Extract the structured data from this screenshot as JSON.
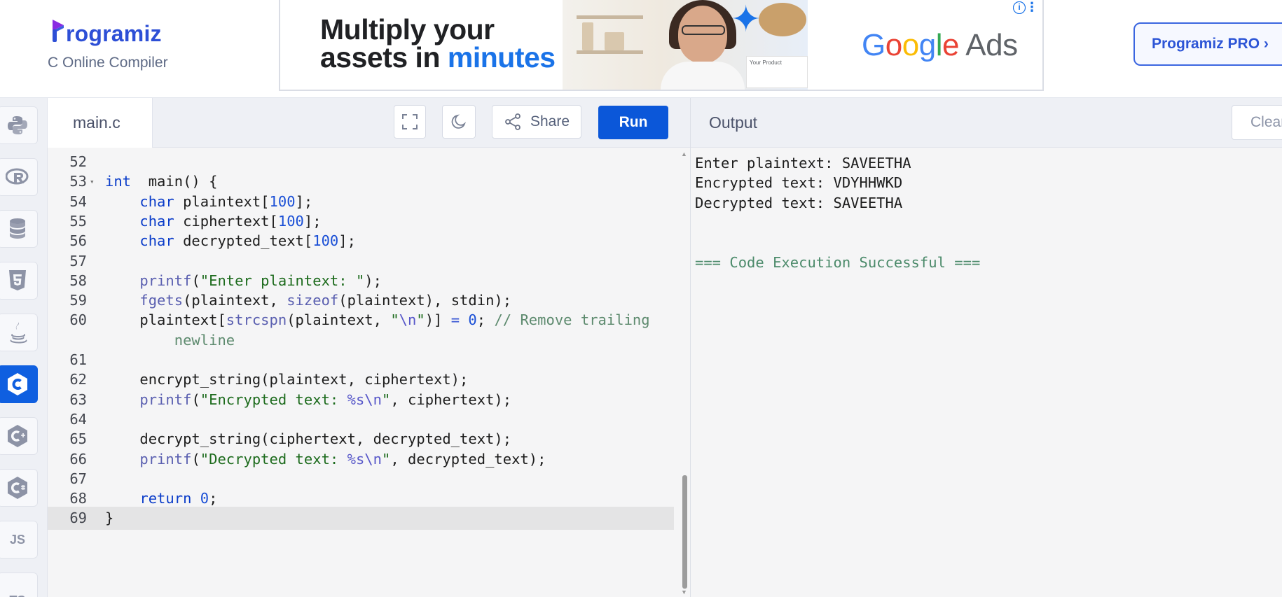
{
  "header": {
    "logo_text": "rogramiz",
    "logo_sub": "C Online Compiler",
    "pro_button": "Programiz PRO ›"
  },
  "ad": {
    "headline_line1": "Multiply your",
    "headline_line2_prefix": "assets in ",
    "headline_line2_highlight": "minutes",
    "brand_google": "Google",
    "brand_ads": "Ads",
    "card_label": "Your Product",
    "info_icon": "ⓘ",
    "menu_icon": "⋮"
  },
  "sidebar": {
    "items": [
      {
        "icon": "python-icon",
        "active": false
      },
      {
        "icon": "r-icon",
        "active": false
      },
      {
        "icon": "database-icon",
        "active": false
      },
      {
        "icon": "html5-icon",
        "active": false
      },
      {
        "icon": "java-icon",
        "active": false
      },
      {
        "icon": "c-icon",
        "active": true
      },
      {
        "icon": "cpp-icon",
        "active": false
      },
      {
        "icon": "csharp-icon",
        "active": false
      },
      {
        "icon": "js-icon",
        "label": "JS",
        "active": false
      },
      {
        "icon": "ts-icon",
        "label": "TS",
        "active": false
      }
    ]
  },
  "editor": {
    "file_tab": "main.c",
    "share_label": "Share",
    "run_label": "Run",
    "current_line": "69",
    "lines": [
      {
        "n": "52",
        "tokens": []
      },
      {
        "n": "53",
        "fold": "▾",
        "tokens": [
          [
            "kw",
            "int"
          ],
          [
            "",
            "  main() {"
          ]
        ]
      },
      {
        "n": "54",
        "tokens": [
          [
            "",
            "    "
          ],
          [
            "kw",
            "char"
          ],
          [
            "",
            " plaintext["
          ],
          [
            "num",
            "100"
          ],
          [
            "",
            "];"
          ]
        ]
      },
      {
        "n": "55",
        "tokens": [
          [
            "",
            "    "
          ],
          [
            "kw",
            "char"
          ],
          [
            "",
            " ciphertext["
          ],
          [
            "num",
            "100"
          ],
          [
            "",
            "];"
          ]
        ]
      },
      {
        "n": "56",
        "tokens": [
          [
            "",
            "    "
          ],
          [
            "kw",
            "char"
          ],
          [
            "",
            " decrypted_text["
          ],
          [
            "num",
            "100"
          ],
          [
            "",
            "];"
          ]
        ]
      },
      {
        "n": "57",
        "tokens": []
      },
      {
        "n": "58",
        "tokens": [
          [
            "",
            "    "
          ],
          [
            "fn",
            "printf"
          ],
          [
            "",
            "("
          ],
          [
            "str",
            "\"Enter plaintext: \""
          ],
          [
            "",
            ");"
          ]
        ]
      },
      {
        "n": "59",
        "tokens": [
          [
            "",
            "    "
          ],
          [
            "fn",
            "fgets"
          ],
          [
            "",
            "(plaintext, "
          ],
          [
            "fn",
            "sizeof"
          ],
          [
            "",
            "(plaintext), stdin);"
          ]
        ]
      },
      {
        "n": "60",
        "tokens": [
          [
            "",
            "    plaintext["
          ],
          [
            "fn",
            "strcspn"
          ],
          [
            "",
            "(plaintext, "
          ],
          [
            "str",
            "\""
          ],
          [
            "esc",
            "\\n"
          ],
          [
            "str",
            "\""
          ],
          [
            "",
            ")] "
          ],
          [
            "op",
            "="
          ],
          [
            "",
            " "
          ],
          [
            "num",
            "0"
          ],
          [
            "",
            "; "
          ],
          [
            "cm",
            "// Remove trailing"
          ]
        ]
      },
      {
        "n": "",
        "tokens": [
          [
            "",
            "        "
          ],
          [
            "cm",
            "newline"
          ]
        ]
      },
      {
        "n": "61",
        "tokens": []
      },
      {
        "n": "62",
        "tokens": [
          [
            "",
            "    encrypt_string(plaintext, ciphertext);"
          ]
        ]
      },
      {
        "n": "63",
        "tokens": [
          [
            "",
            "    "
          ],
          [
            "fn",
            "printf"
          ],
          [
            "",
            "("
          ],
          [
            "str",
            "\"Encrypted text: "
          ],
          [
            "esc",
            "%s\\n"
          ],
          [
            "str",
            "\""
          ],
          [
            "",
            ", ciphertext);"
          ]
        ]
      },
      {
        "n": "64",
        "tokens": []
      },
      {
        "n": "65",
        "tokens": [
          [
            "",
            "    decrypt_string(ciphertext, decrypted_text);"
          ]
        ]
      },
      {
        "n": "66",
        "tokens": [
          [
            "",
            "    "
          ],
          [
            "fn",
            "printf"
          ],
          [
            "",
            "("
          ],
          [
            "str",
            "\"Decrypted text: "
          ],
          [
            "esc",
            "%s\\n"
          ],
          [
            "str",
            "\""
          ],
          [
            "",
            ", decrypted_text);"
          ]
        ]
      },
      {
        "n": "67",
        "tokens": []
      },
      {
        "n": "68",
        "tokens": [
          [
            "",
            "    "
          ],
          [
            "kw",
            "return"
          ],
          [
            "",
            " "
          ],
          [
            "num",
            "0"
          ],
          [
            "",
            ";"
          ]
        ]
      },
      {
        "n": "69",
        "tokens": [
          [
            "",
            "}"
          ]
        ]
      }
    ]
  },
  "output": {
    "title": "Output",
    "clear_label": "Clear",
    "lines": [
      {
        "text": "Enter plaintext: SAVEETHA",
        "type": "normal"
      },
      {
        "text": "Encrypted text: VDYHHWKD",
        "type": "normal"
      },
      {
        "text": "Decrypted text: SAVEETHA",
        "type": "normal"
      },
      {
        "text": "",
        "type": "normal"
      },
      {
        "text": "",
        "type": "normal"
      },
      {
        "text": "=== Code Execution Successful ===",
        "type": "success"
      }
    ]
  },
  "colors": {
    "accent": "#0b57d9",
    "brand": "#2d4fd6",
    "success_text": "#4b8a6a"
  }
}
